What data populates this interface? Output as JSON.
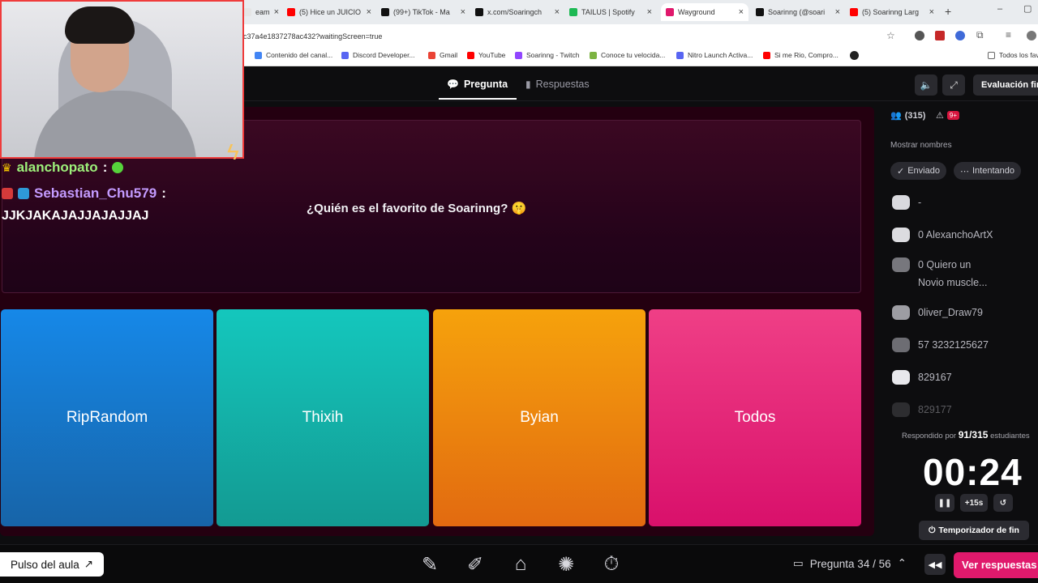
{
  "browser": {
    "tabs": [
      {
        "label": "eam",
        "color": "#e5e5e5"
      },
      {
        "label": "(5) Hice un JUICIO",
        "color": "#ff0000"
      },
      {
        "label": "(99+) TikTok - Ma",
        "color": "#111111"
      },
      {
        "label": "x.com/Soaringch",
        "color": "#111111"
      },
      {
        "label": "TAILUS | Spotify",
        "color": "#1db954"
      },
      {
        "label": "Wayground",
        "color": "#e0196c"
      },
      {
        "label": "Soarinng (@soari",
        "color": "#111111"
      },
      {
        "label": "(5) Soarinng Larg",
        "color": "#ff0000"
      }
    ],
    "new_tab": "+",
    "url": "c37a4e1837278ac432?waitingScreen=true",
    "bookmarks": [
      {
        "label": "Contenido del canal...",
        "color": "#4285f4"
      },
      {
        "label": "Discord Developer...",
        "color": "#5865f2"
      },
      {
        "label": "Gmail",
        "color": "#ea4335"
      },
      {
        "label": "YouTube",
        "color": "#ff0000"
      },
      {
        "label": "Soarinng - Twitch",
        "color": "#9146ff"
      },
      {
        "label": "Conoce tu velocida...",
        "color": "#7cb342"
      },
      {
        "label": "Nitro Launch Activa...",
        "color": "#5865f2"
      },
      {
        "label": "Si me Rio, Compro...",
        "color": "#ff0000"
      }
    ],
    "bookmarks_folder": "Todos los fav"
  },
  "nav": {
    "tab_question": "Pregunta",
    "tab_answers": "Respuestas",
    "eval_button": "Evaluación fin"
  },
  "question": {
    "text": "¿Quién es el favorito de Soarinng? 🤫"
  },
  "answers": [
    {
      "label": "RipRandom",
      "color_top": "#1688e8",
      "color_bottom": "#1764a8"
    },
    {
      "label": "Thixih",
      "color_top": "#14c7bd",
      "color_bottom": "#139a92"
    },
    {
      "label": "Byian",
      "color_top": "#f6a20c",
      "color_bottom": "#e26a10"
    },
    {
      "label": "Todos",
      "color_top": "#ef3f86",
      "color_bottom": "#d9106b"
    }
  ],
  "panel": {
    "participants": "(315)",
    "alerts": "9+",
    "show_names": "Mostrar nombres",
    "filter_sent": "Enviado",
    "filter_trying": "Intentando",
    "students": [
      {
        "name": "-"
      },
      {
        "name": "0 AlexanchoArtX"
      },
      {
        "name": "0 Quiero un"
      },
      {
        "name": "Novio muscle..."
      },
      {
        "name": "0liver_Draw79"
      },
      {
        "name": "57 3232125627"
      },
      {
        "name": "829167"
      },
      {
        "name": "829177"
      }
    ],
    "answered_prefix": "Respondido por",
    "answered_count": "91/315",
    "answered_suffix": "estudiantes",
    "timer": "00:24",
    "add_time": "+15s",
    "end_timer": "Temporizador de fin"
  },
  "bottom": {
    "pulse": "Pulso del aula",
    "question_progress": "Pregunta 34 / 56",
    "see_answers": "Ver respuestas"
  },
  "stream": {
    "chat": [
      {
        "user": "alanchopato",
        "sep": ":",
        "color": "#9df07a"
      },
      {
        "user": "Sebastian_Chu579",
        "sep": ":",
        "color": "#c49bff",
        "message": "JJKJAKAJAJJAJAJJAJ"
      }
    ]
  }
}
